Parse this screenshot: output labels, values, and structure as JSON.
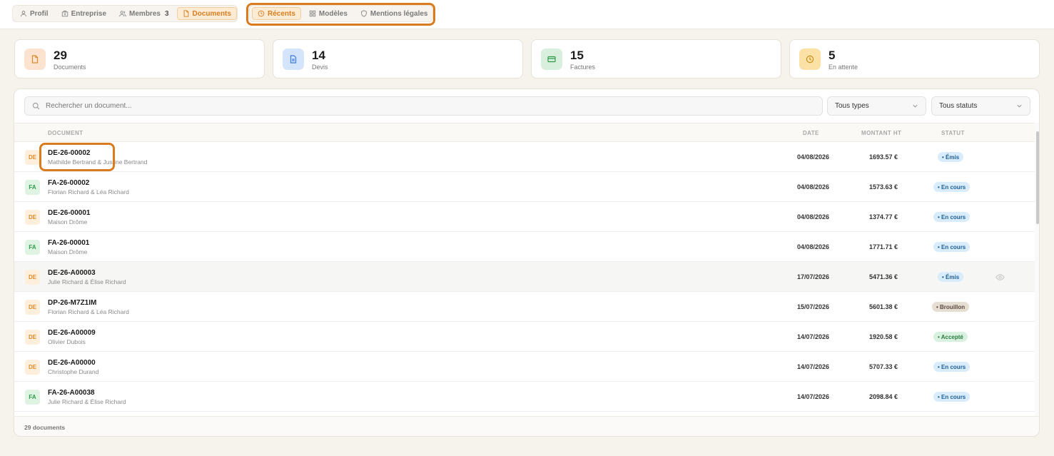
{
  "nav": {
    "profile_tabs": [
      {
        "label": "Profil",
        "icon": "user-icon"
      },
      {
        "label": "Entreprise",
        "icon": "building-icon"
      },
      {
        "label": "Membres",
        "icon": "users-icon",
        "count": "3"
      },
      {
        "label": "Documents",
        "icon": "file-icon",
        "active": true
      }
    ],
    "doc_tabs": [
      {
        "label": "Récents",
        "icon": "clock-icon",
        "active": true
      },
      {
        "label": "Modèles",
        "icon": "grid-icon"
      },
      {
        "label": "Mentions légales",
        "icon": "shield-icon"
      }
    ]
  },
  "stats": [
    {
      "value": "29",
      "label": "Documents",
      "icon": "file-icon",
      "color": "#e08a2c"
    },
    {
      "value": "14",
      "label": "Devis",
      "icon": "file-text-icon",
      "color": "#3b7dd8"
    },
    {
      "value": "15",
      "label": "Factures",
      "icon": "credit-card-icon",
      "color": "#2e9a4b"
    },
    {
      "value": "5",
      "label": "En attente",
      "icon": "clock-icon",
      "color": "#d9a21f"
    }
  ],
  "filters": {
    "search_placeholder": "Rechercher un document...",
    "type_select": "Tous types",
    "status_select": "Tous statuts"
  },
  "table": {
    "headers": {
      "document": "DOCUMENT",
      "date": "DATE",
      "amount": "MONTANT HT",
      "status": "STATUT"
    },
    "rows": [
      {
        "badge": "DE",
        "ref": "DE-26-00002",
        "client": "Mathilde Bertrand & Justine Bertrand",
        "date": "04/08/2026",
        "amount": "1693.57 €",
        "status": "• Émis",
        "status_kind": "emis"
      },
      {
        "badge": "FA",
        "ref": "FA-26-00002",
        "client": "Florian Richard & Léa Richard",
        "date": "04/08/2026",
        "amount": "1573.63 €",
        "status": "• En cours",
        "status_kind": "encours"
      },
      {
        "badge": "DE",
        "ref": "DE-26-00001",
        "client": "Maison Drôme",
        "date": "04/08/2026",
        "amount": "1374.77 €",
        "status": "• En cours",
        "status_kind": "encours"
      },
      {
        "badge": "FA",
        "ref": "FA-26-00001",
        "client": "Maison Drôme",
        "date": "04/08/2026",
        "amount": "1771.71 €",
        "status": "• En cours",
        "status_kind": "encours"
      },
      {
        "badge": "DE",
        "ref": "DE-26-A00003",
        "client": "Julie Richard & Élise Richard",
        "date": "17/07/2026",
        "amount": "5471.36 €",
        "status": "• Émis",
        "status_kind": "emis"
      },
      {
        "badge": "DE",
        "ref": "DP-26-M7Z1IM",
        "client": "Florian Richard & Léa Richard",
        "date": "15/07/2026",
        "amount": "5601.38 €",
        "status": "• Brouillon",
        "status_kind": "brouillon"
      },
      {
        "badge": "DE",
        "ref": "DE-26-A00009",
        "client": "Olivier Dubois",
        "date": "14/07/2026",
        "amount": "1920.58 €",
        "status": "• Accepté",
        "status_kind": "accepte"
      },
      {
        "badge": "DE",
        "ref": "DE-26-A00000",
        "client": "Christophe Durand",
        "date": "14/07/2026",
        "amount": "5707.33 €",
        "status": "• En cours",
        "status_kind": "encours"
      },
      {
        "badge": "FA",
        "ref": "FA-26-A00038",
        "client": "Julie Richard & Élise Richard",
        "date": "14/07/2026",
        "amount": "2098.84 €",
        "status": "• En cours",
        "status_kind": "encours"
      }
    ]
  },
  "footer": {
    "count": "29 documents"
  }
}
